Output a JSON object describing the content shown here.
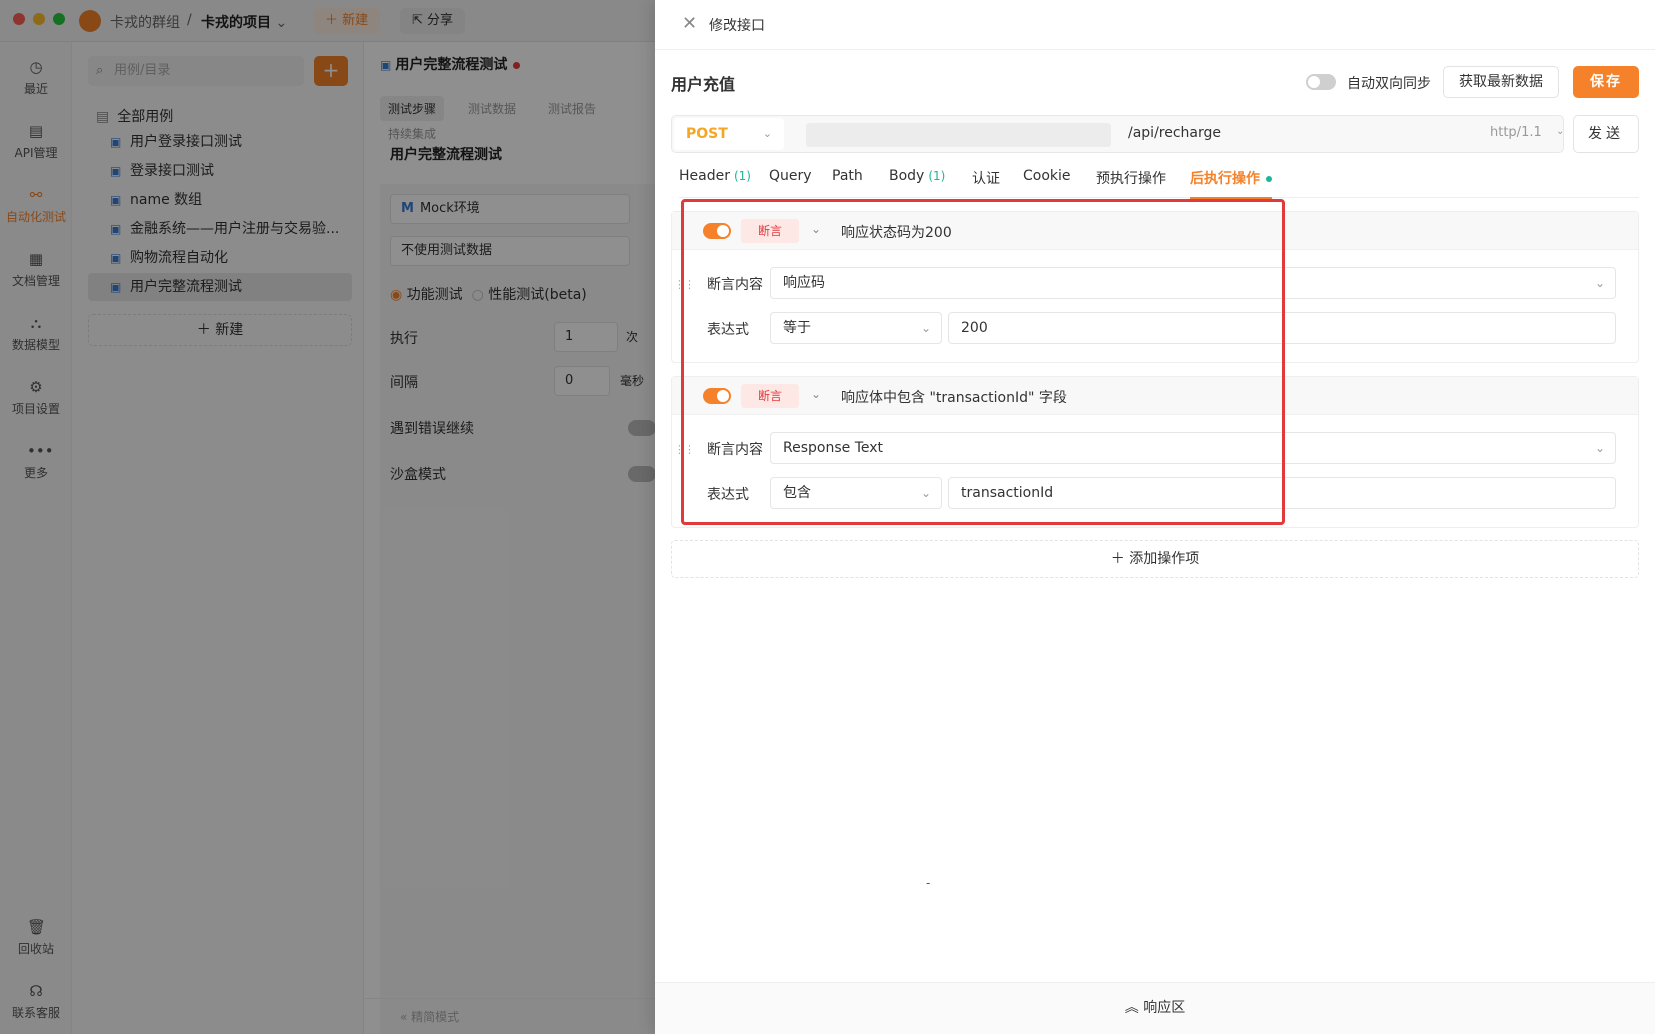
{
  "header": {
    "team": "卡戎的群组",
    "separator": "/",
    "project": "卡戎的项目",
    "project_chev": "⌄",
    "new_btn": "新建",
    "share_btn": "分享"
  },
  "sidebar": {
    "items": [
      {
        "label": "最近",
        "icon": "clock-icon",
        "glyph": "◷"
      },
      {
        "label": "API管理",
        "icon": "api-icon",
        "glyph": "▤"
      },
      {
        "label": "自动化测试",
        "icon": "automation-icon",
        "glyph": "⚯"
      },
      {
        "label": "文档管理",
        "icon": "document-icon",
        "glyph": "▦"
      },
      {
        "label": "数据模型",
        "icon": "model-icon",
        "glyph": "⛬"
      },
      {
        "label": "项目设置",
        "icon": "settings-icon",
        "glyph": "⚙"
      },
      {
        "label": "更多",
        "icon": "more-icon",
        "glyph": "•••"
      }
    ],
    "bottom": [
      {
        "label": "回收站",
        "icon": "trash-icon",
        "glyph": "🗑"
      },
      {
        "label": "联系客服",
        "icon": "headset-icon",
        "glyph": "☊"
      }
    ]
  },
  "tree": {
    "search_placeholder": "用例/目录",
    "root": "全部用例",
    "items": [
      "用户登录接口测试",
      "登录接口测试",
      "name 数组",
      "金融系统——用户注册与交易验...",
      "购物流程自动化",
      "用户完整流程测试"
    ],
    "new_label": "新建"
  },
  "middle": {
    "tab_title": "用户完整流程测试",
    "subtabs": [
      "测试步骤",
      "测试数据",
      "测试报告",
      "持续集成"
    ],
    "title": "用户完整流程测试",
    "env": "Mock环境",
    "env_prefix": "M",
    "data_select": "不使用测试数据",
    "mode_functional": "功能测试",
    "mode_perf": "性能测试(beta)",
    "exec_label": "执行",
    "exec_value": "1",
    "exec_unit": "次",
    "interval_label": "间隔",
    "interval_value": "0",
    "interval_unit": "毫秒",
    "continue_on_error": "遇到错误继续",
    "sandbox": "沙盒模式",
    "footer": "精简模式"
  },
  "drawer": {
    "title": "修改接口",
    "api_name": "用户充值",
    "sync_label": "自动双向同步",
    "sync_on": false,
    "fetch_btn": "获取最新数据",
    "save_btn": "保存",
    "method": "POST",
    "path": "/api/recharge",
    "protocol": "http/1.1",
    "send_btn": "发送",
    "tabs": [
      {
        "label": "Header",
        "count": "(1)"
      },
      {
        "label": "Query",
        "count": ""
      },
      {
        "label": "Path",
        "count": ""
      },
      {
        "label": "Body",
        "count": "(1)"
      },
      {
        "label": "认证",
        "count": ""
      },
      {
        "label": "Cookie",
        "count": ""
      },
      {
        "label": "预执行操作",
        "count": ""
      },
      {
        "label": "后执行操作",
        "count": ""
      }
    ],
    "active_tab": "后执行操作",
    "operations": [
      {
        "enabled": true,
        "tag": "断言",
        "title": "响应状态码为200",
        "content_label": "断言内容",
        "content_value": "响应码",
        "expr_label": "表达式",
        "expr_value": "等于",
        "compare_value": "200"
      },
      {
        "enabled": true,
        "tag": "断言",
        "title": "响应体中包含 \"transactionId\" 字段",
        "content_label": "断言内容",
        "content_value": "Response Text",
        "expr_label": "表达式",
        "expr_value": "包含",
        "compare_value": "transactionId"
      }
    ],
    "add_op": "添加操作项",
    "stray_mark": "-",
    "response_bar": "响应区"
  },
  "colors": {
    "accent": "#f5822a",
    "post": "#f5a623",
    "assert_tag_text": "#e4393c",
    "assert_tag_bg": "#fde8e6",
    "count": "#1fb59a",
    "highlight": "#e03a3a"
  }
}
